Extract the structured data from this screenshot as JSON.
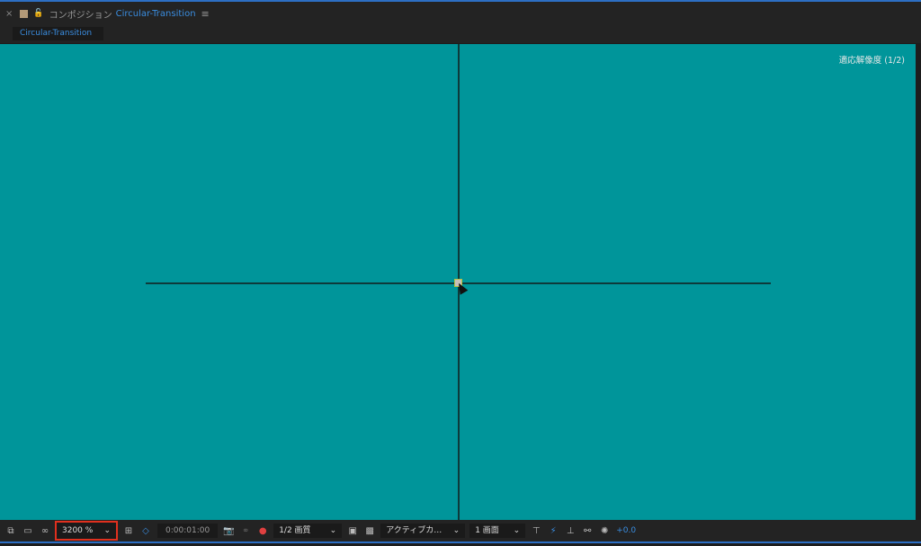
{
  "header": {
    "close": "×",
    "panel_label": "コンポジション",
    "comp_name": "Circular-Transition",
    "menu": "≡"
  },
  "tab": {
    "label": "Circular-Transition"
  },
  "viewer": {
    "resolution": "適応解像度 (1/2)",
    "bg_color": "#00959a"
  },
  "toolbar": {
    "zoom": "3200 %",
    "timecode": "0:00:01:00",
    "quality": "1/2 画質",
    "camera": "アクティブカ…",
    "views": "1 画面",
    "exposure": "+0.0",
    "chevron": "⌄"
  }
}
